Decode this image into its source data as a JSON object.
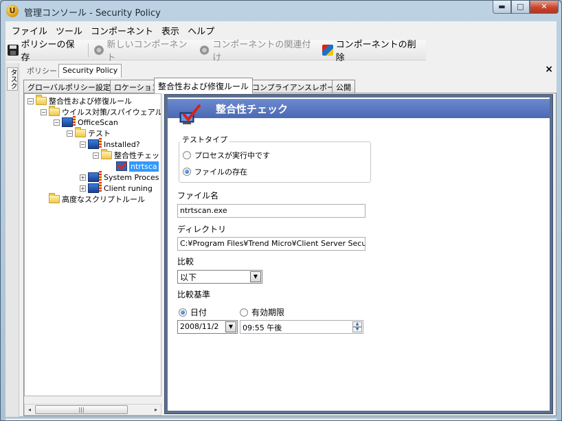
{
  "window": {
    "title": "管理コンソール - Security Policy",
    "app_icon_glyph": "U",
    "buttons": {
      "minimize": "▬",
      "maximize": "□",
      "close": "✕"
    }
  },
  "menu": [
    "ファイル",
    "ツール",
    "コンポーネント",
    "表示",
    "ヘルプ"
  ],
  "toolbar": {
    "save_policy": "ポリシーの保存",
    "new_component": "新しいコンポーネント",
    "associate_component": "コンポーネントの関連付け",
    "delete_component": "コンポーネントの削除"
  },
  "side_panel": {
    "label": "タスク"
  },
  "policy": {
    "label": "ポリシー",
    "name": "Security Policy",
    "close_glyph": "×"
  },
  "tabs": [
    "グローバルポリシー設定",
    "ロケーション",
    "整合性および修復ルール",
    "コンプライアンスレポート",
    "公開"
  ],
  "active_tab_index": 2,
  "tree": [
    {
      "label": "整合性および修復ルール",
      "twisty": "−",
      "icon": "folder"
    },
    {
      "label": "ウイルス対策/スパイウェアル",
      "twisty": "−",
      "icon": "folder"
    },
    {
      "label": "OfficeScan",
      "twisty": "−",
      "icon": "pc"
    },
    {
      "label": "テスト",
      "twisty": "−",
      "icon": "folder"
    },
    {
      "label": "Installed?",
      "twisty": "−",
      "icon": "pc"
    },
    {
      "label": "整合性チェッ",
      "twisty": "−",
      "icon": "folder"
    },
    {
      "label": "ntrtsca",
      "twisty": "",
      "icon": "check",
      "selected": true
    },
    {
      "label": "System Proces",
      "twisty": "+",
      "icon": "pc"
    },
    {
      "label": "Client runing",
      "twisty": "+",
      "icon": "pc"
    },
    {
      "label": "高度なスクリプトルール",
      "twisty": "",
      "icon": "folder"
    }
  ],
  "tree_scroll": {
    "left": "◂",
    "right": "▸",
    "thumb": "|||"
  },
  "content": {
    "title": "整合性チェック",
    "test_type": {
      "label": "テストタイプ",
      "options": [
        "プロセスが実行中です",
        "ファイルの存在"
      ],
      "selected_index": 1
    },
    "file_name": {
      "label": "ファイル名",
      "value": "ntrtscan.exe"
    },
    "directory": {
      "label": "ディレクトリ",
      "value": "C:¥Program Files¥Trend Micro¥Client Server Secur"
    },
    "comparison": {
      "label": "比較",
      "value": "以下"
    },
    "comparison_basis": {
      "label": "比較基準",
      "options": [
        "日付",
        "有効期限"
      ],
      "selected_index": 0
    },
    "date_value": "2008/11/2",
    "time_value": "09:55 午後",
    "dropdown_glyph": "▼",
    "spin_up": "▲",
    "spin_down": "▼"
  },
  "colors": {
    "header_bg": "#5a78c4",
    "frame_bg": "#5a6f90",
    "selection": "#3399ff",
    "close_button": "#c8452e"
  }
}
